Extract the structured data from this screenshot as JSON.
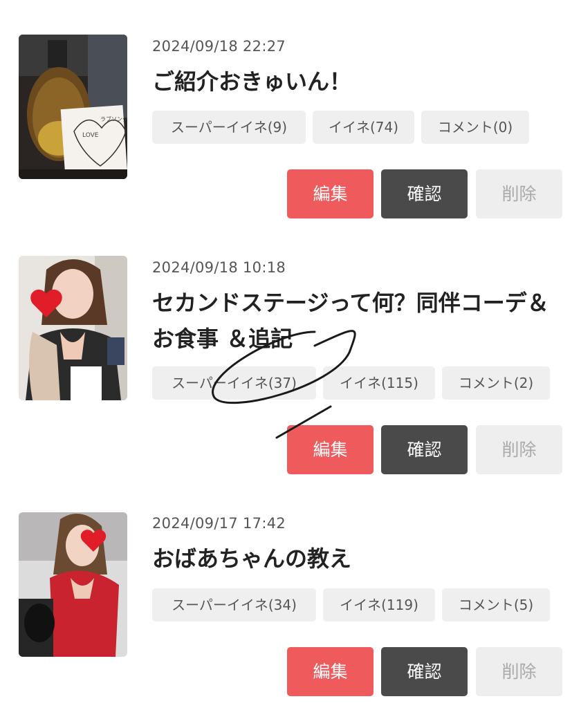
{
  "posts": [
    {
      "date": "2024/09/18 22:27",
      "title": "ご紹介おきゅいん！",
      "super_like": "スーパーイイネ(9)",
      "like": "イイネ(74)",
      "comment": "コメント(0)",
      "thumbnail_icon": "bottle-photo"
    },
    {
      "date": "2024/09/18 10:18",
      "title": "セカンドステージって何？同伴コーデ＆お食事 ＆追記",
      "super_like": "スーパーイイネ(37)",
      "like": "イイネ(115)",
      "comment": "コメント(2)",
      "thumbnail_icon": "person-photo"
    },
    {
      "date": "2024/09/17 17:42",
      "title": "おばあちゃんの教え",
      "super_like": "スーパーイイネ(34)",
      "like": "イイネ(119)",
      "comment": "コメント(5)",
      "thumbnail_icon": "person-photo"
    }
  ],
  "buttons": {
    "edit": "編集",
    "confirm": "確認",
    "delete": "削除"
  },
  "colors": {
    "edit": "#ef5a5c",
    "confirm": "#4a4a4a",
    "delete": "#eeeeee",
    "chip": "#efefef"
  }
}
